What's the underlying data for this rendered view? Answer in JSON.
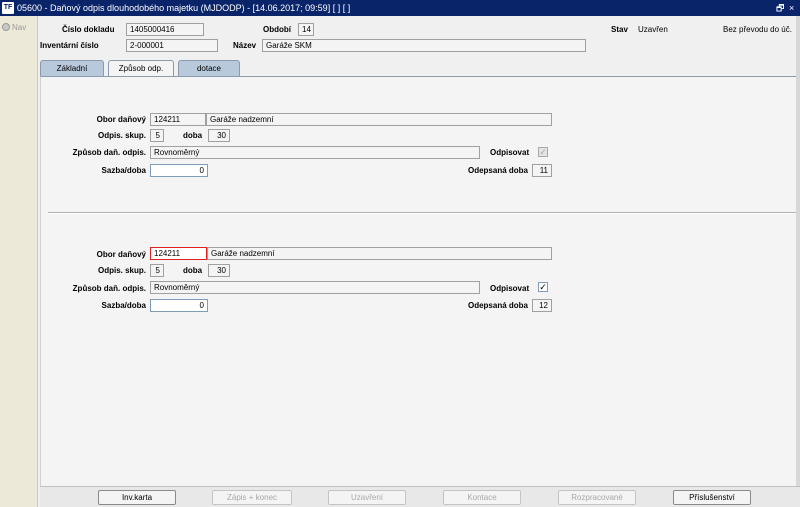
{
  "window": {
    "title": "05600 - Daňový odpis dlouhodobého majetku (MJDODP) - [14.06.2017; 09:59]  [ ]  [ ]",
    "app_icon": "TF",
    "restore_glyph": "🗗",
    "close_glyph": "×"
  },
  "nav": {
    "label": "Nav"
  },
  "header": {
    "cislo_dokladu_label": "Číslo dokladu",
    "cislo_dokladu_value": "1405000416",
    "obdobi_label": "Období",
    "obdobi_value": "14",
    "stav_label": "Stav",
    "stav_value": "Uzavřen",
    "prevod_text": "Bez převodu do úč.",
    "inventarni_label": "Inventární číslo",
    "inventarni_value": "2-000001",
    "nazev_label": "Název",
    "nazev_value": "Garáže SKM"
  },
  "tabs": [
    {
      "label": "Základní"
    },
    {
      "label": "Způsob odp."
    },
    {
      "label": "dotace"
    }
  ],
  "section1": {
    "obor_label": "Obor daňový",
    "obor_code": "124211",
    "obor_name": "Garáže nadzemní",
    "skup_label": "Odpis. skup.",
    "skup_value": "5",
    "doba_label": "doba",
    "doba_value": "30",
    "zpusob_label": "Způsob daň. odpis.",
    "zpusob_value": "Rovnoměrný",
    "odpisovat_label": "Odpisovat",
    "odpisovat_checked": true,
    "sazba_label": "Sazba/doba",
    "sazba_value": "0",
    "odepsana_label": "Odepsaná doba",
    "odepsana_value": "11"
  },
  "section2": {
    "obor_label": "Obor daňový",
    "obor_code": "124211",
    "obor_name": "Garáže nadzemní",
    "skup_label": "Odpis. skup.",
    "skup_value": "5",
    "doba_label": "doba",
    "doba_value": "30",
    "zpusob_label": "Způsob daň. odpis.",
    "zpusob_value": "Rovnoměrný",
    "odpisovat_label": "Odpisovat",
    "odpisovat_checked": true,
    "sazba_label": "Sazba/doba",
    "sazba_value": "0",
    "odepsana_label": "Odepsaná doba",
    "odepsana_value": "12"
  },
  "footer": {
    "buttons": [
      {
        "label": "Inv.karta",
        "enabled": true
      },
      {
        "label": "Zápis + konec",
        "enabled": false
      },
      {
        "label": "Uzavření",
        "enabled": false
      },
      {
        "label": "Kontace",
        "enabled": false
      },
      {
        "label": "Rozpracované",
        "enabled": false
      },
      {
        "label": "Příslušenství",
        "enabled": true
      }
    ]
  },
  "colors": {
    "titlebar": "#0a246a",
    "tab_inactive": "#b9c9dc",
    "error_border": "#e02020"
  },
  "icons": {
    "app": "app-logo-icon",
    "nav": "nav-bullet-icon",
    "restore": "restore-window-icon",
    "close": "close-window-icon",
    "check": "checkmark-icon"
  },
  "check_glyph": "✓"
}
